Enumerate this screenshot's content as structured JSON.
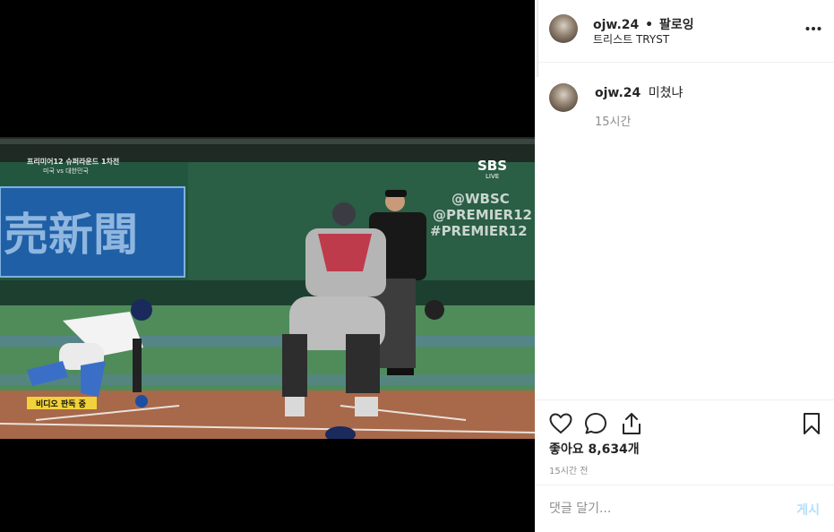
{
  "video": {
    "scoreboard_line1": "프리미어12 슈퍼라운드 1차전",
    "scoreboard_line2": "미국 vs 대한민국",
    "broadcaster": "SBS",
    "broadcaster_sub": "LIVE",
    "wall_text_1": "@WBSC",
    "wall_text_2": "@PREMIER12",
    "wall_text_3": "#PREMIER12",
    "sign_text": "売新聞",
    "caption": "비디오 판독 중"
  },
  "header": {
    "username": "ojw.24",
    "separator": "•",
    "follow_status": "팔로잉",
    "subtitle": "트리스트 TRYST",
    "more_icon": "more-horizontal-icon"
  },
  "comment": {
    "username": "ojw.24",
    "text": "미쳤냐",
    "time": "15시간"
  },
  "actions": {
    "like_icon": "heart-icon",
    "comment_icon": "comment-icon",
    "share_icon": "share-icon",
    "save_icon": "bookmark-icon",
    "likes": "좋아요 8,634개",
    "posted": "15시간 전"
  },
  "add_comment": {
    "placeholder": "댓글 달기...",
    "post_label": "게시",
    "post_color": "#b2dffc"
  }
}
